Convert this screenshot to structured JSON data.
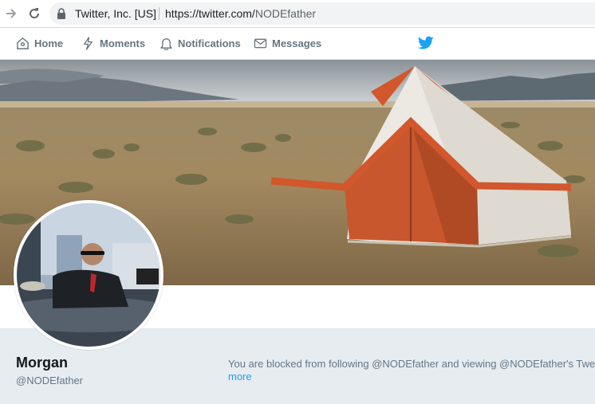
{
  "browser": {
    "site_identity": "Twitter, Inc. [US]",
    "url_host": "https://twitter.com/",
    "url_path": "NODEfather"
  },
  "nav": {
    "items": [
      {
        "label": "Home",
        "icon": "home-icon"
      },
      {
        "label": "Moments",
        "icon": "lightning-icon"
      },
      {
        "label": "Notifications",
        "icon": "bell-icon"
      },
      {
        "label": "Messages",
        "icon": "envelope-icon"
      }
    ],
    "logo": "twitter-bird-icon"
  },
  "profile": {
    "name": "Morgan",
    "handle": "@NODEfather",
    "blocked_message": "You are blocked from following @NODEfather and viewing @NODEfather's Tweets.",
    "more_label": "more"
  },
  "colors": {
    "twitter_blue": "#1da1f2",
    "tent_orange": "#d2572c",
    "muted_text": "#657786",
    "page_background": "#e6ecf0"
  }
}
